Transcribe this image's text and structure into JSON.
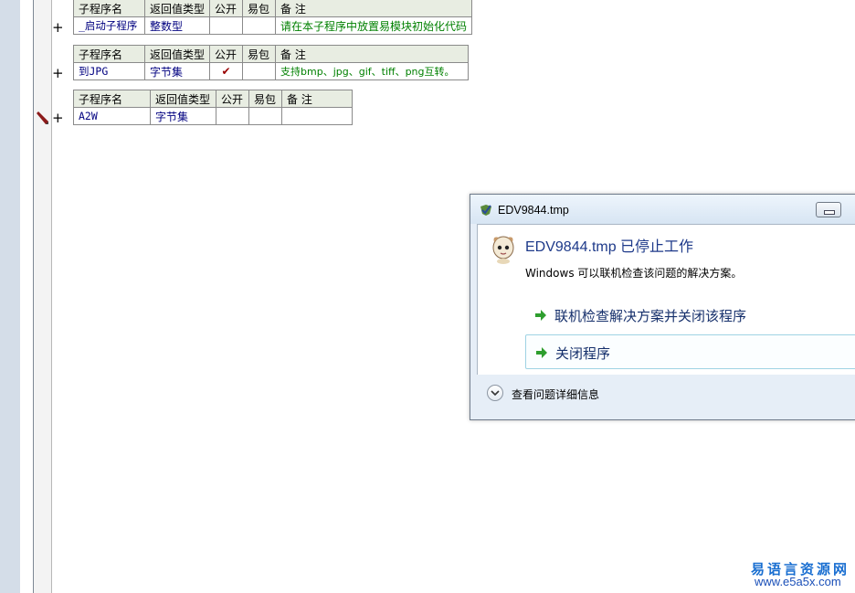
{
  "tables": [
    {
      "headers": [
        "子程序名",
        "返回值类型",
        "公开",
        "易包",
        "备 注"
      ],
      "row": {
        "name": "_启动子程序",
        "type": "整数型",
        "public": "",
        "epkg": "",
        "note": "请在本子程序中放置易模块初始化代码"
      }
    },
    {
      "headers": [
        "子程序名",
        "返回值类型",
        "公开",
        "易包",
        "备 注"
      ],
      "row": {
        "name": "到JPG",
        "type": "字节集",
        "public": "✔",
        "epkg": "",
        "note": "支持bmp、jpg、gif、tiff、png互转。"
      }
    },
    {
      "headers": [
        "子程序名",
        "返回值类型",
        "公开",
        "易包",
        "备 注"
      ],
      "row": {
        "name": "A2W",
        "type": "字节集",
        "public": "",
        "epkg": "",
        "note": ""
      }
    }
  ],
  "gutter": {
    "expand_symbol": "+",
    "edit_marker_icon": "pencil-icon"
  },
  "dialog": {
    "title": "EDV9844.tmp",
    "heading": "EDV9844.tmp 已停止工作",
    "description": "Windows 可以联机检查该问题的解决方案。",
    "option_online": "联机检查解决方案并关闭该程序",
    "option_close": "关闭程序",
    "details_label": "查看问题详细信息",
    "icons": {
      "title": "shield-app-icon",
      "app": "cartoon-app-icon",
      "arrow": "green-arrow-icon",
      "details": "chevron-down-icon"
    }
  },
  "watermark": {
    "line1": "易语言资源网",
    "line2": "www.e5a5x.com"
  },
  "colors": {
    "header_bg": "#e8ede2",
    "name_text": "#000080",
    "note_text": "#008000",
    "dialog_heading": "#1e3a8a",
    "arrow": "#2e9e2e"
  }
}
